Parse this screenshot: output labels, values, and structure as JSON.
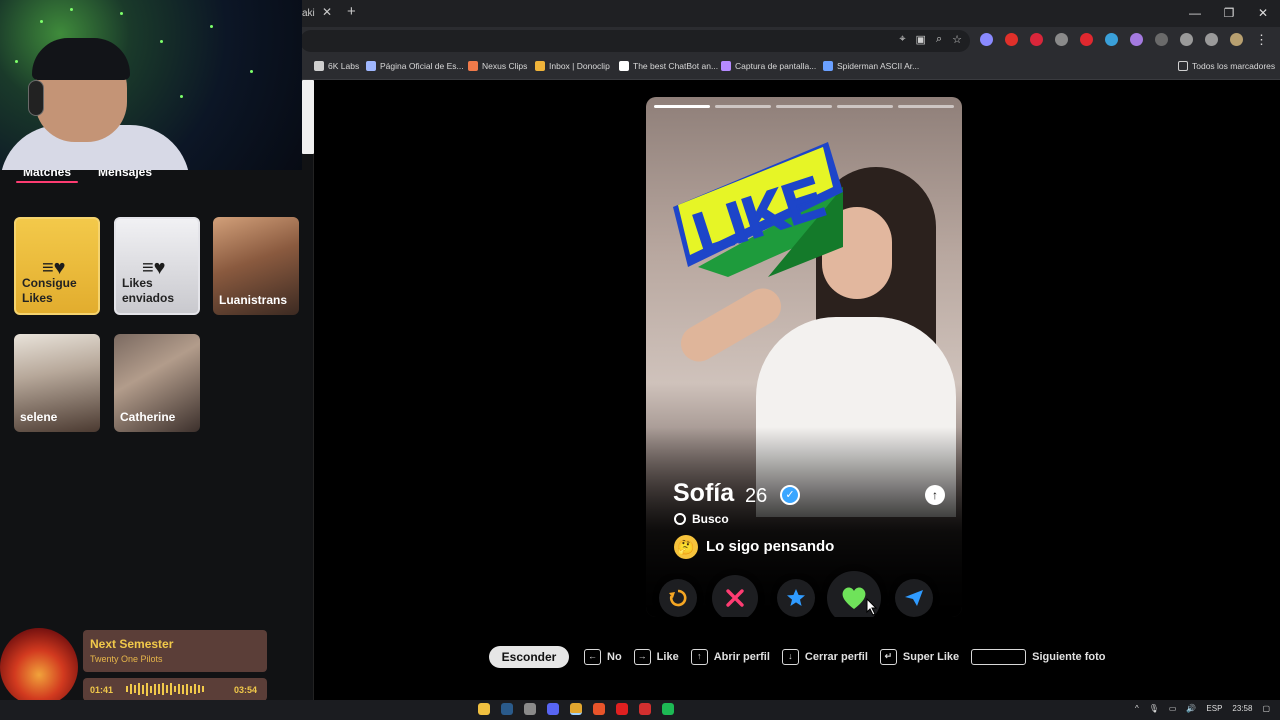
{
  "browser": {
    "tab_fragment": "aki",
    "tab_close": "✕",
    "new_tab": "+",
    "bookmarks": [
      {
        "label": "6K Labs",
        "color": "#cfcfcf"
      },
      {
        "label": "Página Oficial de Es...",
        "color": "#9fb7ff"
      },
      {
        "label": "Nexus Clips",
        "color": "#f07a4a"
      },
      {
        "label": "Inbox | Donoclip",
        "color": "#f0b43a"
      },
      {
        "label": "The best ChatBot an...",
        "color": "#ffffff"
      },
      {
        "label": "Captura de pantalla...",
        "color": "#b58aff"
      },
      {
        "label": "Spiderman ASCII Ar...",
        "color": "#6aa0ff"
      }
    ],
    "all_bookmarks": "Todos los marcadores"
  },
  "sidebar": {
    "tabs": [
      "Matches",
      "Mensajes"
    ],
    "cards": [
      {
        "label": "Consigue Likes"
      },
      {
        "label": "Likes enviados"
      },
      {
        "label": "Luanistrans"
      },
      {
        "label": "selene"
      },
      {
        "label": "Catherine"
      }
    ]
  },
  "music": {
    "title": "Next Semester",
    "artist": "Twenty One Pilots",
    "elapsed": "01:41",
    "total": "03:54",
    "progress": 0.43
  },
  "profile": {
    "sticker_text": "LIKE",
    "name": "Sofía",
    "age": "26",
    "looking_for": "Busco",
    "status": "Lo sigo pensando",
    "photo_index": 1,
    "photo_count": 5
  },
  "hints": {
    "hide_button": "Esconder",
    "items": [
      {
        "label": "No",
        "key": "←"
      },
      {
        "label": "Like",
        "key": "→"
      },
      {
        "label": "Abrir perfil",
        "key": "↑"
      },
      {
        "label": "Cerrar perfil",
        "key": "↓"
      },
      {
        "label": "Super Like",
        "key": "↵"
      },
      {
        "label": "Siguiente foto",
        "key": ""
      }
    ]
  },
  "taskbar": {
    "lang": "ESP",
    "time": "23:58"
  }
}
